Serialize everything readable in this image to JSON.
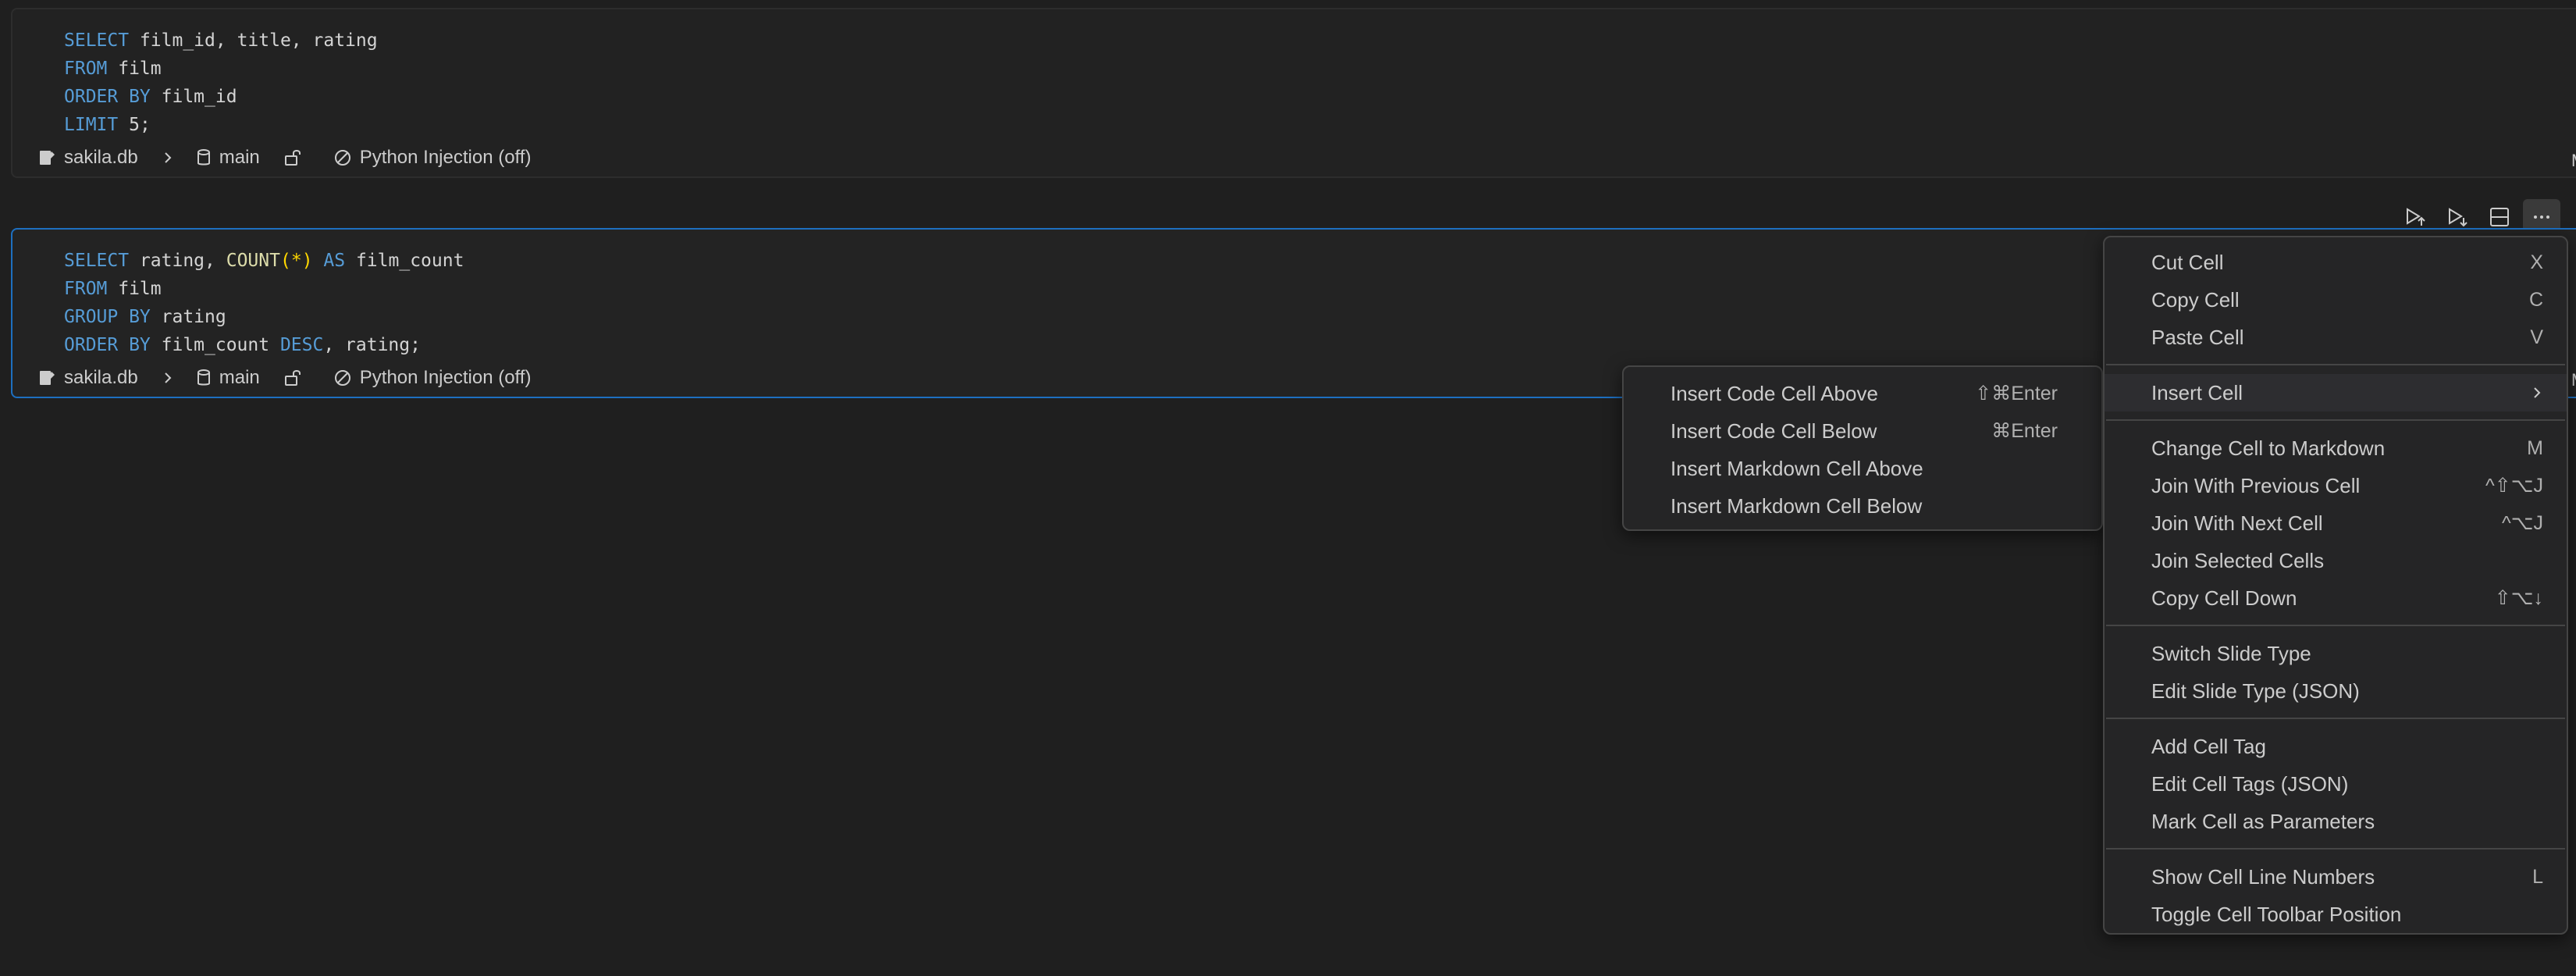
{
  "cells": [
    {
      "code": [
        [
          {
            "t": "SELECT",
            "c": "kw"
          },
          {
            "t": " film_id, title, rating"
          }
        ],
        [
          {
            "t": "FROM",
            "c": "kw"
          },
          {
            "t": " film"
          }
        ],
        [
          {
            "t": "ORDER BY",
            "c": "kw"
          },
          {
            "t": " film_id"
          }
        ],
        [
          {
            "t": "LIMIT",
            "c": "kw"
          },
          {
            "t": " 5;"
          }
        ]
      ],
      "status": {
        "database": "sakila.db",
        "schema": "main",
        "injection": "Python Injection (off)"
      }
    },
    {
      "code": [
        [
          {
            "t": "SELECT",
            "c": "kw"
          },
          {
            "t": " rating, "
          },
          {
            "t": "COUNT",
            "c": "fn"
          },
          {
            "t": "(",
            "c": "pn"
          },
          {
            "t": "*",
            "c": "pn"
          },
          {
            "t": ")",
            "c": "pn"
          },
          {
            "t": " "
          },
          {
            "t": "AS",
            "c": "kw"
          },
          {
            "t": " film_count"
          }
        ],
        [
          {
            "t": "FROM",
            "c": "kw"
          },
          {
            "t": " film"
          }
        ],
        [
          {
            "t": "GROUP BY",
            "c": "kw"
          },
          {
            "t": " rating"
          }
        ],
        [
          {
            "t": "ORDER BY",
            "c": "kw"
          },
          {
            "t": " film_count "
          },
          {
            "t": "DESC",
            "c": "kw"
          },
          {
            "t": ", rating;"
          }
        ]
      ],
      "status": {
        "database": "sakila.db",
        "schema": "main",
        "injection": "Python Injection (off)"
      }
    }
  ],
  "edge_marks": [
    "M",
    "M"
  ],
  "context_menu": {
    "groups": [
      [
        {
          "label": "Cut Cell",
          "shortcut": "X"
        },
        {
          "label": "Copy Cell",
          "shortcut": "C"
        },
        {
          "label": "Paste Cell",
          "shortcut": "V"
        }
      ],
      [
        {
          "label": "Insert Cell",
          "shortcut": "",
          "submenu": true
        }
      ],
      [
        {
          "label": "Change Cell to Markdown",
          "shortcut": "M"
        },
        {
          "label": "Join With Previous Cell",
          "shortcut": "^⇧⌥J"
        },
        {
          "label": "Join With Next Cell",
          "shortcut": "^⌥J"
        },
        {
          "label": "Join Selected Cells",
          "shortcut": ""
        },
        {
          "label": "Copy Cell Down",
          "shortcut": "⇧⌥↓"
        }
      ],
      [
        {
          "label": "Switch Slide Type",
          "shortcut": ""
        },
        {
          "label": "Edit Slide Type (JSON)",
          "shortcut": ""
        }
      ],
      [
        {
          "label": "Add Cell Tag",
          "shortcut": ""
        },
        {
          "label": "Edit Cell Tags (JSON)",
          "shortcut": ""
        },
        {
          "label": "Mark Cell as Parameters",
          "shortcut": ""
        }
      ],
      [
        {
          "label": "Show Cell Line Numbers",
          "shortcut": "L"
        },
        {
          "label": "Toggle Cell Toolbar Position",
          "shortcut": ""
        }
      ]
    ]
  },
  "insert_submenu": {
    "items": [
      {
        "label": "Insert Code Cell Above",
        "shortcut": "⇧⌘Enter"
      },
      {
        "label": "Insert Code Cell Below",
        "shortcut": "⌘Enter"
      },
      {
        "label": "Insert Markdown Cell Above",
        "shortcut": ""
      },
      {
        "label": "Insert Markdown Cell Below",
        "shortcut": ""
      }
    ]
  },
  "icons": {
    "toolbar": [
      "execute-above-icon",
      "execute-below-icon",
      "split-cell-icon",
      "more-actions-icon"
    ],
    "status": [
      "notebook-icon",
      "chevron-right-icon",
      "database-icon",
      "unlock-icon",
      "slash-circle-icon"
    ]
  },
  "colors": {
    "background": "#1f1f1f",
    "keyword": "#569cd6",
    "function": "#dcdcaa",
    "punctuation": "#ffd700",
    "focus_border": "#1d6fc0",
    "menu_bg": "#252526"
  }
}
